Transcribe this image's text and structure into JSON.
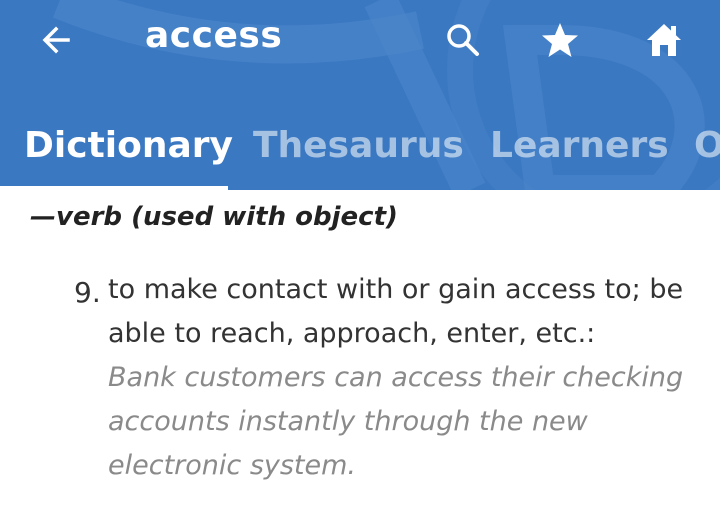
{
  "app": {
    "accent_color": "#3b78c2",
    "search_term": "access"
  },
  "toolbar": {
    "back_icon": "arrow-left-icon",
    "search_icon": "search-icon",
    "favorite_icon": "star-icon",
    "home_icon": "home-icon"
  },
  "tabs": [
    {
      "label": "Dictionary",
      "active": true
    },
    {
      "label": "Thesaurus",
      "active": false
    },
    {
      "label": "Learners",
      "active": false
    },
    {
      "label": "O",
      "active": false
    }
  ],
  "entry": {
    "part_of_speech": "—verb (used with object)",
    "definition": {
      "number": "9.",
      "text": "to make contact with or gain access to; be able to reach, approach, enter, etc.:",
      "example": "Bank customers can access their checking accounts instantly through the new electronic system."
    }
  }
}
